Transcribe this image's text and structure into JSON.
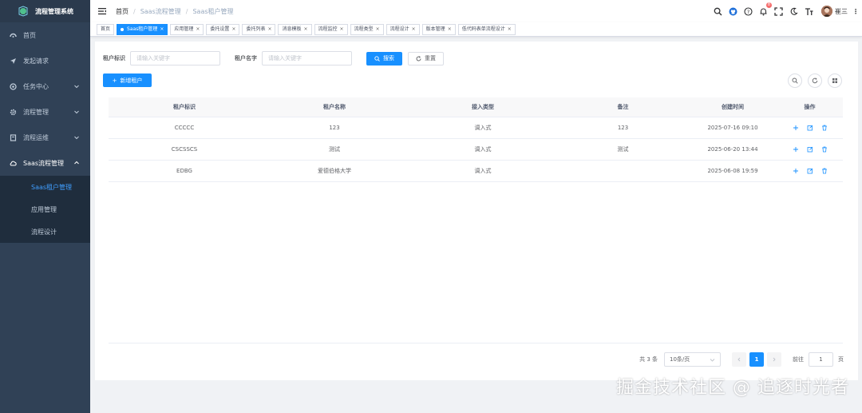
{
  "app": {
    "title": "流程管理系统"
  },
  "colors": {
    "sidebar_bg": "#304156",
    "accent": "#1890ff",
    "active_text": "#409eff",
    "badge": "#f56c6c"
  },
  "sidebar": {
    "items": [
      {
        "label": "首页",
        "icon": "dashboard-icon"
      },
      {
        "label": "发起请求",
        "icon": "send-icon"
      },
      {
        "label": "任务中心",
        "icon": "task-icon",
        "expandable": true
      },
      {
        "label": "流程管理",
        "icon": "gear-icon",
        "expandable": true
      },
      {
        "label": "流程运维",
        "icon": "clipboard-icon",
        "expandable": true
      },
      {
        "label": "Saas流程管理",
        "icon": "cloud-icon",
        "expandable": true,
        "expanded": true
      }
    ],
    "submenu": [
      {
        "label": "Saas租户管理",
        "active": true
      },
      {
        "label": "应用管理"
      },
      {
        "label": "流程设计"
      }
    ]
  },
  "navbar": {
    "breadcrumb": [
      "首页",
      "Saas流程管理",
      "Saas租户管理"
    ],
    "notification_count": "8",
    "username": "崔三"
  },
  "tags": [
    {
      "label": "首页",
      "active": false,
      "closable": false
    },
    {
      "label": "Saas租户管理",
      "active": true,
      "closable": true
    },
    {
      "label": "应用管理",
      "active": false,
      "closable": true
    },
    {
      "label": "委托设置",
      "active": false,
      "closable": true
    },
    {
      "label": "委托列表",
      "active": false,
      "closable": true
    },
    {
      "label": "消息模板",
      "active": false,
      "closable": true
    },
    {
      "label": "流程监控",
      "active": false,
      "closable": true
    },
    {
      "label": "流程类型",
      "active": false,
      "closable": true
    },
    {
      "label": "流程设计",
      "active": false,
      "closable": true
    },
    {
      "label": "版本管理",
      "active": false,
      "closable": true
    },
    {
      "label": "低代码表单流程设计",
      "active": false,
      "closable": true
    }
  ],
  "search": {
    "tenant_id_label": "租户标识",
    "tenant_id_placeholder": "请输入关键字",
    "tenant_name_label": "租户名字",
    "tenant_name_placeholder": "请输入关键字",
    "search_btn": "搜索",
    "reset_btn": "重置"
  },
  "toolbar": {
    "add_btn": "新增租户"
  },
  "table": {
    "columns": [
      "租户标识",
      "租户名称",
      "接入类型",
      "备注",
      "创建时间",
      "操作"
    ],
    "rows": [
      {
        "id": "CCCCC",
        "name": "123",
        "type": "调入式",
        "remark": "123",
        "created": "2025-07-16 09:10"
      },
      {
        "id": "CSCSSCS",
        "name": "测试",
        "type": "调入式",
        "remark": "测试",
        "created": "2025-06-20 13:44"
      },
      {
        "id": "EDBG",
        "name": "爱德伯格大学",
        "type": "调入式",
        "remark": "",
        "created": "2025-06-08 19:59"
      }
    ]
  },
  "pagination": {
    "total": "共 3 条",
    "page_size": "10条/页",
    "current_page": "1",
    "goto_label": "前往",
    "goto_value": "1",
    "page_suffix": "页"
  },
  "watermark": "掘金技术社区 @ 追逐时光者"
}
